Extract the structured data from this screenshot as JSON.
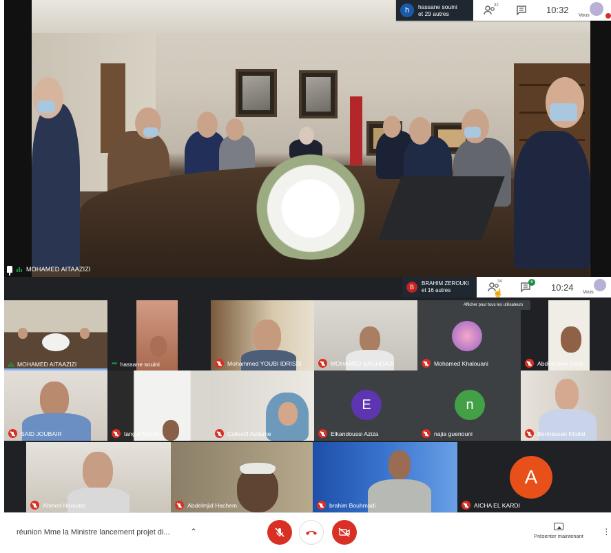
{
  "top_window": {
    "presenter_initial": "h",
    "presenter_name": "hassane souini",
    "presenter_others": "et 29 autres",
    "participants_count": "32",
    "time": "10:32",
    "self_label": "Vous",
    "pinned_name": "MOHAMED AITAAZIZI"
  },
  "mid_window": {
    "presenter_initial": "B",
    "presenter_name": "BRAHIM ZEROUKI",
    "presenter_others": "et 16 autres",
    "participants_count": "34",
    "chat_badge": "6",
    "time": "10:24",
    "self_label": "Vous",
    "tooltip": "Afficher pour tous les utilisateurs"
  },
  "tiles": [
    {
      "name": "MOHAMED AITAAZIZI",
      "muted": false,
      "speaking": true
    },
    {
      "name": "hassane souini",
      "muted": false,
      "speaking": true
    },
    {
      "name": "Mohammed YOUBI IDRISSI",
      "muted": true
    },
    {
      "name": "MOHAMED BAGHDADI",
      "muted": true
    },
    {
      "name": "Mohamed Khalouani",
      "muted": true
    },
    {
      "name": "Abdelmalek Asrih",
      "muted": true
    },
    {
      "name": "SAID JOUBAIR",
      "muted": true
    },
    {
      "name": "tanger Maroc",
      "muted": true
    },
    {
      "name": "Collectif Autisme",
      "muted": true
    },
    {
      "name": "Elkandoussi Aziza",
      "muted": true,
      "initial": "E"
    },
    {
      "name": "najia guenouni",
      "muted": true,
      "initial": "n"
    },
    {
      "name": "Benhassan Khalid",
      "muted": true
    },
    {
      "name": "Ahmed Haouate",
      "muted": true
    },
    {
      "name": "Abdelmjid Hachem",
      "muted": true
    },
    {
      "name": "brahim Bouhmadi",
      "muted": true
    },
    {
      "name": "AICHA EL KARDI",
      "muted": true,
      "initial": "A"
    }
  ],
  "bottom_bar": {
    "meeting_title": "réunion Mme la Ministre lancement projet di...",
    "present_label": "Présenter maintenant"
  },
  "colors": {
    "mute_red": "#d93025",
    "speaking_green": "#1e8e3e",
    "avatar_E": "#5e35b1",
    "avatar_n": "#43a047",
    "avatar_A": "#e8501a"
  }
}
